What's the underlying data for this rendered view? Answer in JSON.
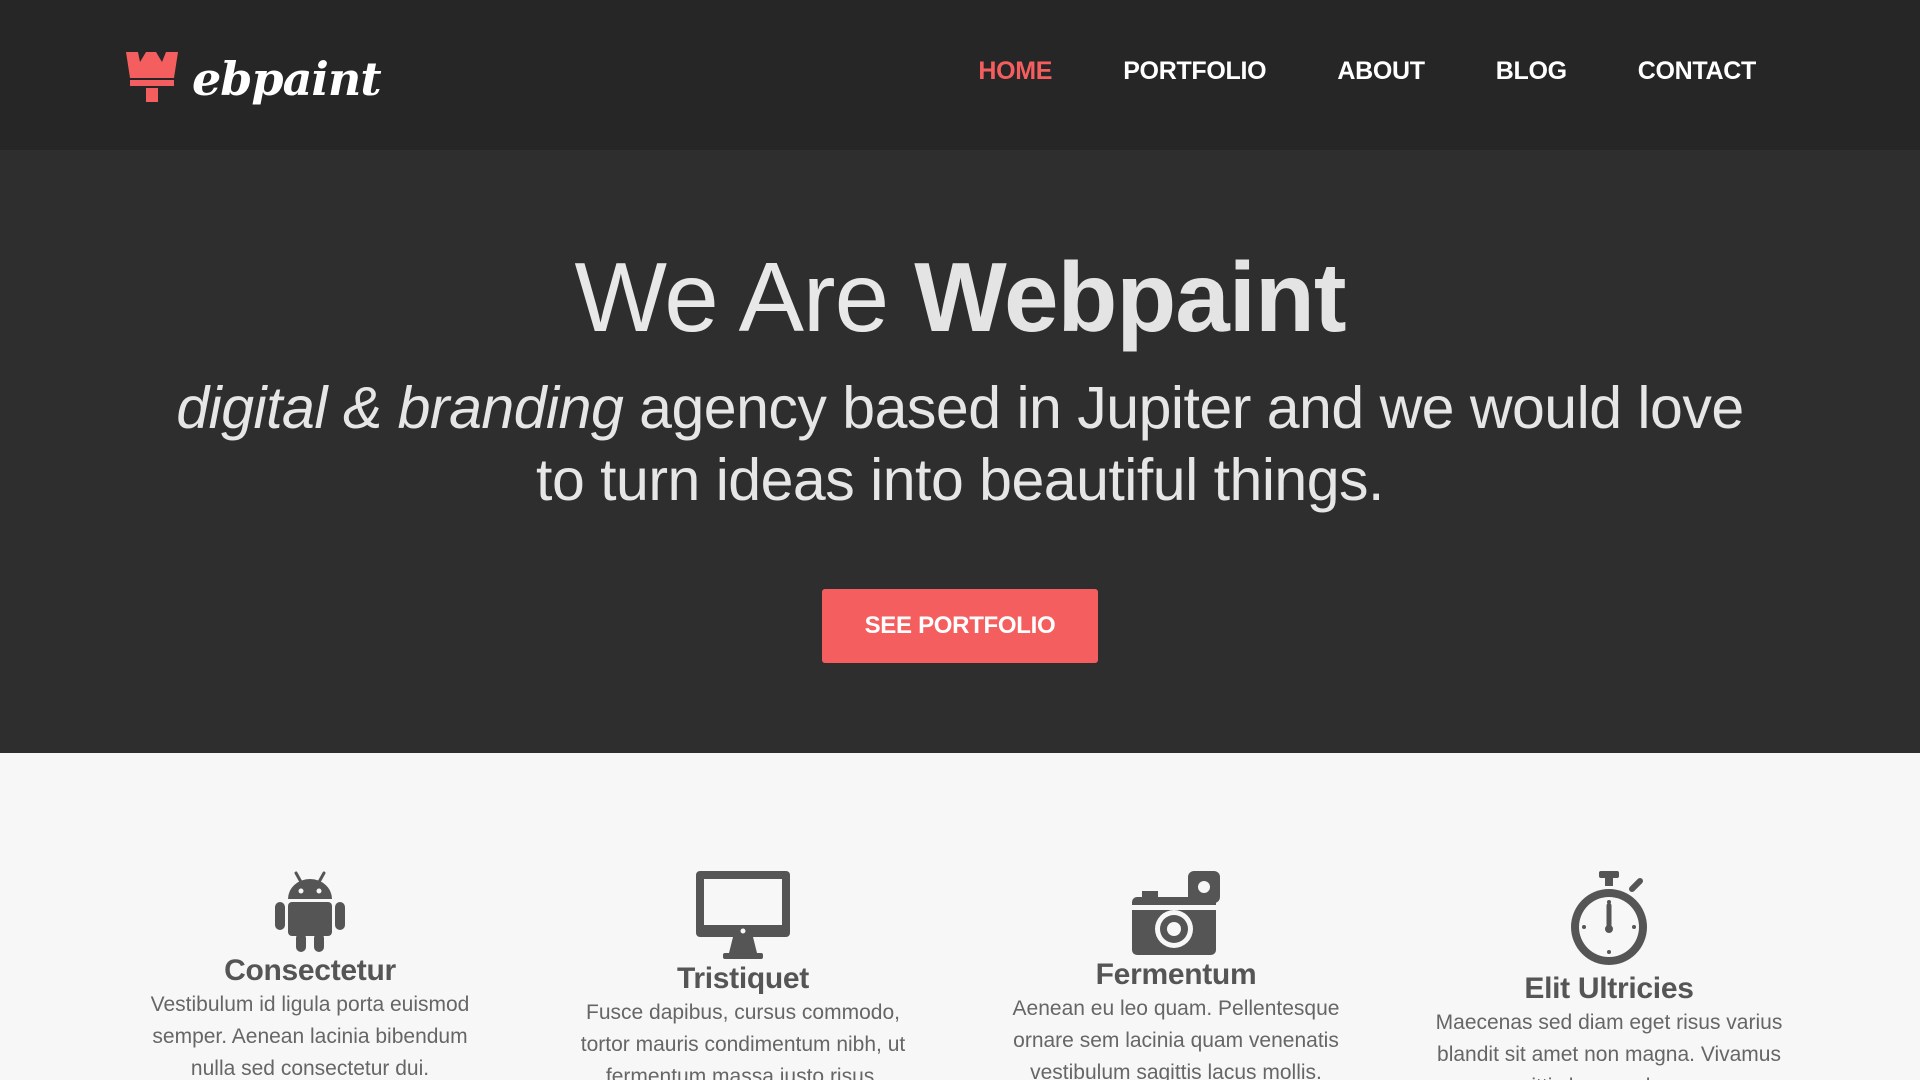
{
  "brand": {
    "logo_text": "ebpaint",
    "accent": "#f55e5e"
  },
  "nav": {
    "items": [
      {
        "label": "HOME",
        "active": true
      },
      {
        "label": "PORTFOLIO",
        "active": false
      },
      {
        "label": "ABOUT",
        "active": false
      },
      {
        "label": "BLOG",
        "active": false
      },
      {
        "label": "CONTACT",
        "active": false
      }
    ]
  },
  "hero": {
    "title_light": "We Are ",
    "title_bold": "Webpaint",
    "subtitle_italic": "digital & branding",
    "subtitle_rest": " agency based in Jupiter and we would love to turn ideas into beautiful things.",
    "cta_label": "SEE PORTFOLIO"
  },
  "features": [
    {
      "icon": "android-icon",
      "title": "Consectetur",
      "text": "Vestibulum id ligula porta euismod semper. Aenean lacinia bibendum nulla sed consectetur dui."
    },
    {
      "icon": "monitor-icon",
      "title": "Tristiquet",
      "text": "Fusce dapibus, cursus commodo, tortor mauris condimentum nibh, ut fermentum massa justo risus."
    },
    {
      "icon": "camera-icon",
      "title": "Fermentum",
      "text": "Aenean eu leo quam. Pellentesque ornare sem lacinia quam venenatis vestibulum sagittis lacus mollis."
    },
    {
      "icon": "stopwatch-icon",
      "title": "Elit Ultricies",
      "text": "Maecenas sed diam eget risus varius blandit sit amet non magna. Vivamus sagittis lacus vel augue."
    }
  ]
}
